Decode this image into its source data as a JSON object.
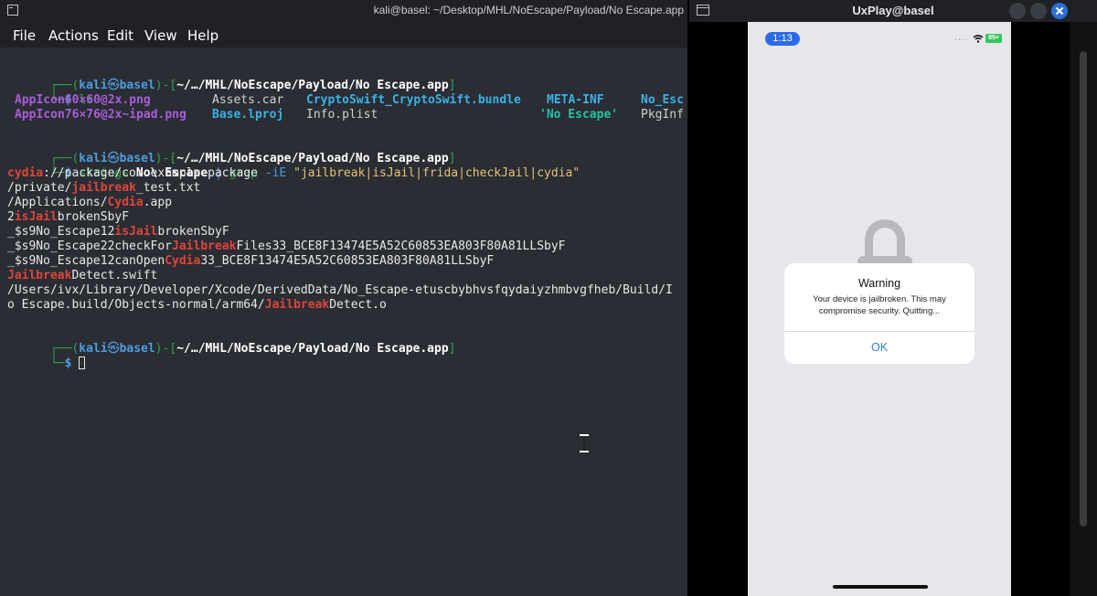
{
  "terminal": {
    "title": "kali@basel: ~/Desktop/MHL/NoEscape/Payload/No Escape.app",
    "menu": [
      "File",
      "Actions",
      "Edit",
      "View",
      "Help"
    ],
    "prompt_box_top": "┌──(",
    "prompt_user": "kali",
    "prompt_at": "㉿",
    "prompt_host": "basel",
    "prompt_close": ")-[",
    "prompt_path": "~/…/MHL/NoEscape/Payload/No Escape.app",
    "prompt_end": "]",
    "prompt_box_bottom": "└─",
    "prompt_dollar": "$ ",
    "cmd1": "ls",
    "ls_row1": {
      "a": "AppIcon60×60@2x.png",
      "b": "Assets.car",
      "c": "CryptoSwift_CryptoSwift.bundle",
      "d": "META-INF",
      "e": "No_Esc"
    },
    "ls_row2": {
      "a": "AppIcon76×76@2x~ipad.png",
      "b": "Base.lproj",
      "c": "Info.plist",
      "d": "'No Escape'",
      "e": "PkgInf"
    },
    "cmd2": {
      "strings": "strings",
      "arg": "No\\ Escape",
      "pipe": "|",
      "grep": "grep",
      "flag": "-iE",
      "pattern": "\"jailbreak|isJail|frida|checkJail|cydia\""
    },
    "out": {
      "l1_hit": "cydia",
      "l1_rest": "://package/com.example.package",
      "l2_pre": "/private/",
      "l2_hit": "jailbreak",
      "l2_post": "_test.txt",
      "l3_pre": "/Applications/",
      "l3_hit": "Cydia",
      "l3_post": ".app",
      "l4_pre": "2",
      "l4_hit": "isJail",
      "l4_post": "brokenSbyF",
      "l5_pre": "_$s9No_Escape12",
      "l5_hit": "isJail",
      "l5_post": "brokenSbyF",
      "l6_pre": "_$s9No_Escape22checkFor",
      "l6_hit": "Jailbreak",
      "l6_post": "Files33_BCE8F13474E5A52C60853EA803F80A81LLSbyF",
      "l7_pre": "_$s9No_Escape12canOpen",
      "l7_hit": "Cydia",
      "l7_post": "33_BCE8F13474E5A52C60853EA803F80A81LLSbyF",
      "l8_hit": "Jailbreak",
      "l8_post": "Detect.swift",
      "l9": "/Users/ivx/Library/Developer/Xcode/DerivedData/No_Escape-etuscbybhvsfqydaiyzhmbvgfheb/Build/I",
      "l10_pre": "o Escape.build/Objects-normal/arm64/",
      "l10_hit": "Jailbreak",
      "l10_post": "Detect.o"
    }
  },
  "uxplay": {
    "title": "UxPlay@basel",
    "phone": {
      "status_time": "1:13",
      "status_dots": "....",
      "battery": "85+",
      "alert_title": "Warning",
      "alert_message": "Your device is jailbroken. This may compromise security. Quitting...",
      "alert_button": "OK"
    }
  },
  "icons": [
    "terminal-app-icon",
    "window-app-icon",
    "wifi-icon",
    "battery-icon",
    "lock-icon",
    "close-icon",
    "text-cursor-icon"
  ]
}
